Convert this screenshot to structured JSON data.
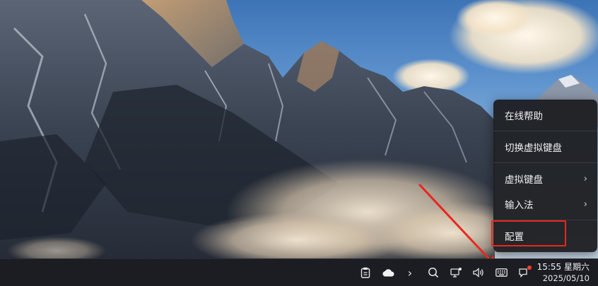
{
  "wallpaper": {
    "description_icon": "mountain-wallpaper"
  },
  "context_menu": {
    "items": [
      {
        "label": "在线帮助",
        "has_submenu": false
      },
      {
        "label": "切换虚拟键盘",
        "has_submenu": false
      },
      {
        "label": "虚拟键盘",
        "has_submenu": true
      },
      {
        "label": "输入法",
        "has_submenu": true
      },
      {
        "label": "配置",
        "has_submenu": false
      }
    ],
    "submenu_glyph": "›",
    "highlighted_item": "配置"
  },
  "taskbar": {
    "tray_icons": [
      "clipboard-icon",
      "cloud-icon",
      "expand-tray-icon",
      "search-icon",
      "network-icon",
      "volume-icon",
      "keyboard-icon",
      "notification-icon"
    ],
    "expand_glyph": "›",
    "clock": {
      "time": "15:55",
      "weekday": "星期六",
      "date": "2025/05/10"
    }
  },
  "colors": {
    "annotation_red": "#e8271f",
    "menu_bg": "#1e1f22",
    "taskbar_bg": "#1b1d22"
  }
}
